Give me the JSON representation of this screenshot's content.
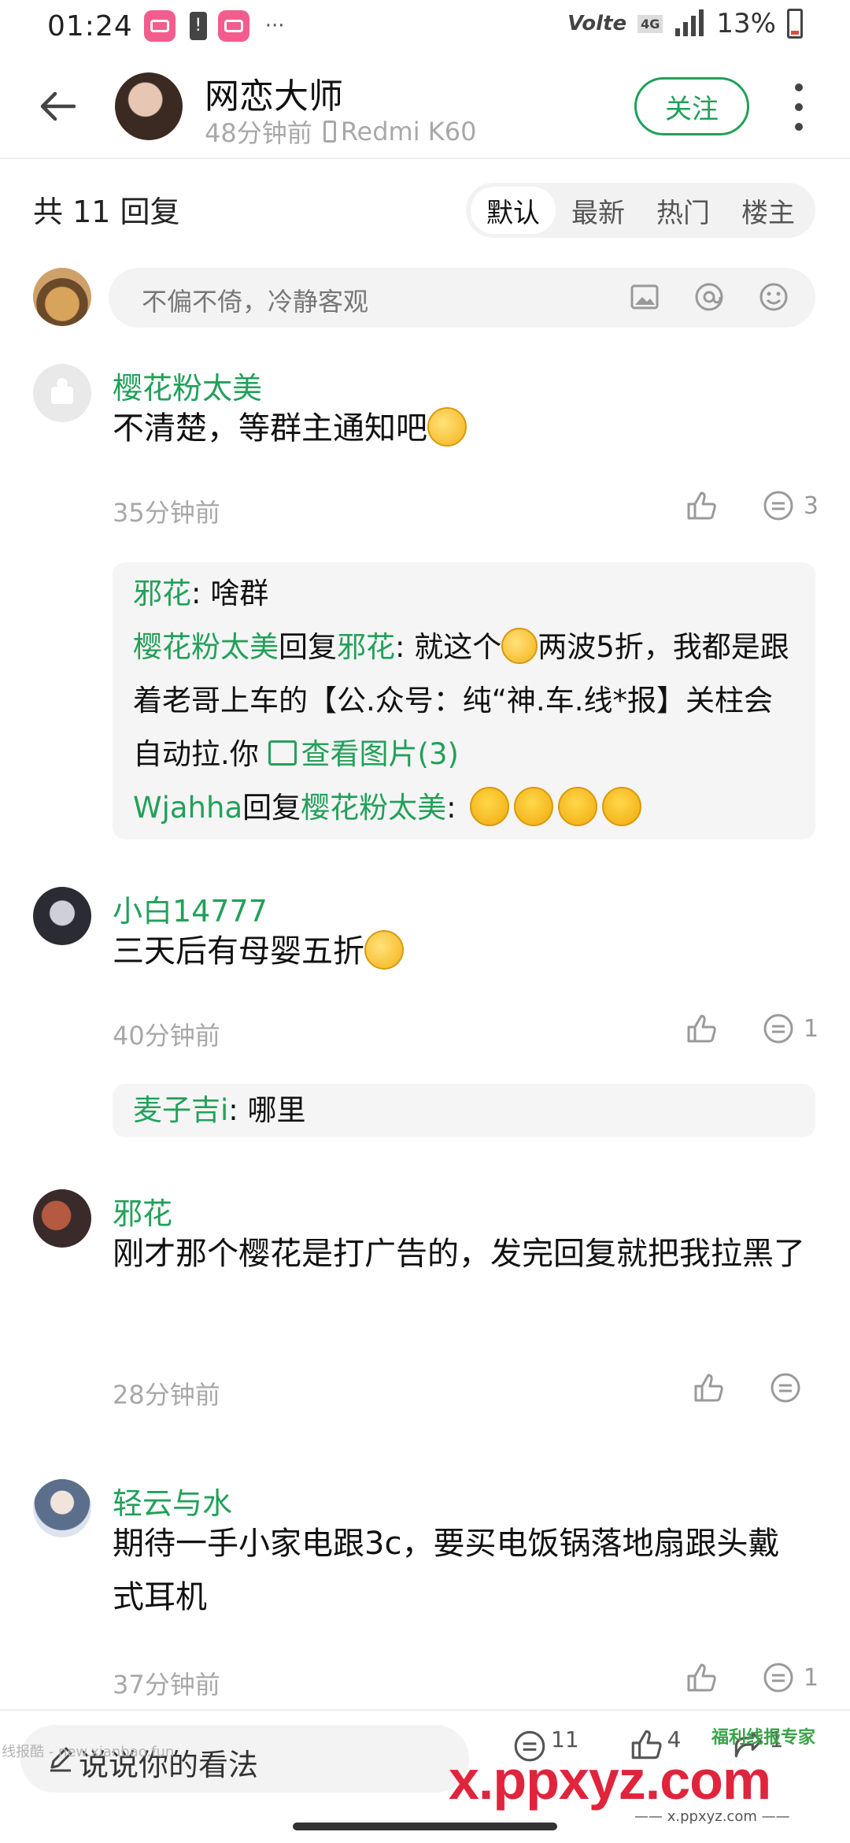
{
  "status_bar": {
    "time": "01:24",
    "notification_dots": "···",
    "volte": "Volte",
    "network": "4G",
    "battery_percent": "13%"
  },
  "header": {
    "author_name": "网恋大师",
    "post_time": "48分钟前",
    "device": "Redmi K60",
    "follow_label": "关注"
  },
  "replies": {
    "count_label": "共 11 回复",
    "sort_tabs": [
      "默认",
      "最新",
      "热门",
      "楼主"
    ],
    "active_tab": "默认"
  },
  "comment_input": {
    "placeholder": "不偏不倚，冷静客观"
  },
  "comments": [
    {
      "user": "樱花粉太美",
      "text": "不清楚，等群主通知吧",
      "time": "35分钟前",
      "reply_count": "3",
      "sub_replies": [
        {
          "user": "邪花",
          "reply_to": "",
          "text": ": 啥群"
        },
        {
          "user": "樱花粉太美",
          "reply_word": "回复",
          "reply_to": "邪花",
          "text_a": ": 就这个",
          "text_b": "两波5折，我都是跟着老哥上车的【公.众号：纯“神.车.线*报】关柱会自动拉.你",
          "image_link": "查看图片(3)"
        },
        {
          "user": "Wjahha",
          "reply_word": "回复",
          "reply_to": "樱花粉太美",
          "text": ": "
        }
      ]
    },
    {
      "user": "小白14777",
      "text": "三天后有母婴五折",
      "time": "40分钟前",
      "reply_count": "1",
      "sub_replies": [
        {
          "user": "麦子吉i",
          "text": ": 哪里"
        }
      ]
    },
    {
      "user": "邪花",
      "text": "刚才那个樱花是打广告的，发完回复就把我拉黑了",
      "time": "28分钟前",
      "reply_count": ""
    },
    {
      "user": "轻云与水",
      "text": "期待一手小家电跟3c，要买电饭锅落地扇跟头戴式耳机",
      "time": "37分钟前",
      "reply_count": "1"
    }
  ],
  "bottom_bar": {
    "placeholder": "说说你的看法",
    "comments_count": "11",
    "likes_count": "4",
    "shares_count": "1"
  },
  "watermarks": {
    "left": "线报酷 - new.xianbao.fun",
    "right": "x.ppxyz.com",
    "right_sub": "—— x.ppxyz.com ——",
    "badge": "福利线报专家"
  },
  "colors": {
    "accent_green": "#22a05a",
    "watermark_red": "#e0243c"
  }
}
